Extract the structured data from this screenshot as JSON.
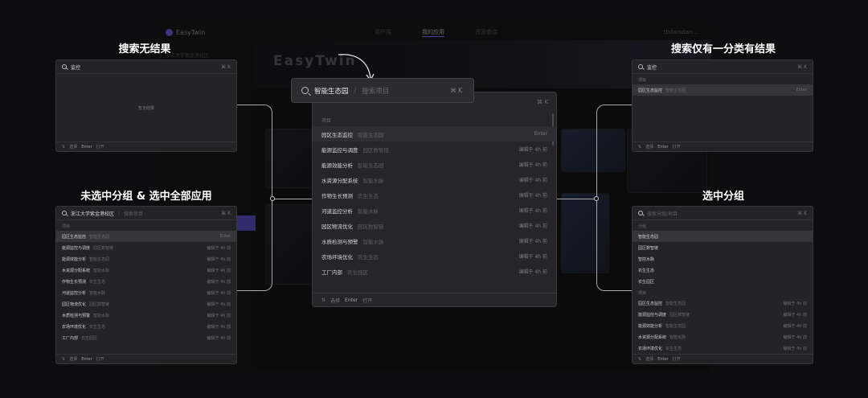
{
  "background_app": {
    "brand": "EasyTwin",
    "nav": [
      "用户端",
      "我的应用",
      "资源商店"
    ],
    "user": "tbdarsdan...",
    "logo": "EasyTwin",
    "sidebar_title": "浙江大学紫金港校区"
  },
  "headings": {
    "top_left": "搜索无结果",
    "top_right": "搜索仅有一分类有结果",
    "mid_left": "未选中分组 & 选中全部应用",
    "mid_right": "选中分组"
  },
  "main_palette": {
    "search_value": "智能生态园",
    "search_placeholder": "搜索项目",
    "search_shortcut": "⌘ K",
    "inner_shortcut": "⌘ K",
    "section": "项目",
    "rows": [
      {
        "title": "园区生态监控",
        "sub": "智能生态园",
        "right": "Enter"
      },
      {
        "title": "能源监控与调度",
        "sub": "园区数智链",
        "right": "编辑于 4h 前"
      },
      {
        "title": "能源效能分析",
        "sub": "智能生态园",
        "right": "编辑于 4h 前"
      },
      {
        "title": "水资源分配系统",
        "sub": "智能水脉",
        "right": "编辑于 4h 前"
      },
      {
        "title": "作物生长预测",
        "sub": "农生生态",
        "right": "编辑于 4h 前"
      },
      {
        "title": "河道监控分析",
        "sub": "智能水脉",
        "right": "编辑于 4h 前"
      },
      {
        "title": "园区物流优化",
        "sub": "园区数智链",
        "right": "编辑于 4h 前"
      },
      {
        "title": "水质检测与预警",
        "sub": "智能水脉",
        "right": "编辑于 4h 前"
      },
      {
        "title": "农场环境优化",
        "sub": "农生生态",
        "right": "编辑于 4h 前"
      },
      {
        "title": "工厂内部",
        "sub": "农生园区",
        "right": "编辑于 4h 前"
      }
    ],
    "footer": {
      "keys": "⇅",
      "nav_label": "选择",
      "enter_key": "Enter",
      "enter_label": "打开"
    }
  },
  "panel_no_result": {
    "search_value": "监控",
    "shortcut": "⌘ K",
    "empty_text": "暂无结果",
    "footer": {
      "keys": "⇅",
      "nav_label": "选择",
      "enter_key": "Enter",
      "enter_label": "打开"
    }
  },
  "panel_one_category": {
    "search_value": "监控",
    "shortcut": "⌘ K",
    "section": "项目",
    "rows": [
      {
        "title": "园区生态监控",
        "sub": "智能生态园",
        "right": "Enter"
      }
    ],
    "footer": {
      "keys": "⇅",
      "nav_label": "选择",
      "enter_key": "Enter",
      "enter_label": "打开"
    }
  },
  "panel_all_apps": {
    "search_value": "浙江大学紫金港校区",
    "search_placeholder": "搜索项目",
    "shortcut": "⌘ K",
    "section": "项目",
    "rows": [
      {
        "title": "园区生态监控",
        "sub": "智能生态园",
        "right": "Enter"
      },
      {
        "title": "能源监控与调度",
        "sub": "园区数智链",
        "right": "编辑于 4h 前"
      },
      {
        "title": "能源效能分析",
        "sub": "智能生态园",
        "right": "编辑于 4h 前"
      },
      {
        "title": "水资源分配系统",
        "sub": "智能水脉",
        "right": "编辑于 4h 前"
      },
      {
        "title": "作物生长预测",
        "sub": "农生生态",
        "right": "编辑于 4h 前"
      },
      {
        "title": "河道监控分析",
        "sub": "智能水脉",
        "right": "编辑于 4h 前"
      },
      {
        "title": "园区物流优化",
        "sub": "园区数智链",
        "right": "编辑于 4h 前"
      },
      {
        "title": "水质检测与预警",
        "sub": "智能水脉",
        "right": "编辑于 4h 前"
      },
      {
        "title": "农场环境优化",
        "sub": "农生生态",
        "right": "编辑于 4h 前"
      },
      {
        "title": "工厂内部",
        "sub": "农生园区",
        "right": "编辑于 4h 前"
      }
    ],
    "footer": {
      "keys": "⇅",
      "nav_label": "选择",
      "enter_key": "Enter",
      "enter_label": "打开"
    }
  },
  "panel_group": {
    "search_placeholder": "搜索分组/项目",
    "shortcut": "⌘ K",
    "group_section": "分组",
    "groups": [
      "智能生态园",
      "园区数智链",
      "智控水脉",
      "农生生态",
      "农生园区"
    ],
    "project_section": "项目",
    "rows": [
      {
        "title": "园区生态监控",
        "sub": "智能生态园",
        "right": "编辑于 4h 前"
      },
      {
        "title": "能源监控与调度",
        "sub": "园区数智链",
        "right": "编辑于 4h 前"
      },
      {
        "title": "能源效能分析",
        "sub": "智能生态园",
        "right": "编辑于 4h 前"
      },
      {
        "title": "水资源分配系统",
        "sub": "智能水脉",
        "right": "编辑于 4h 前"
      },
      {
        "title": "农场环境优化",
        "sub": "农生生态",
        "right": "编辑于 4h 前"
      }
    ],
    "footer": {
      "keys": "⇅",
      "nav_label": "选择",
      "enter_key": "Enter",
      "enter_label": "打开"
    }
  },
  "colors": {
    "accent": "#5a4fc6",
    "background": "#0d0d0f",
    "panel": "#242426"
  }
}
